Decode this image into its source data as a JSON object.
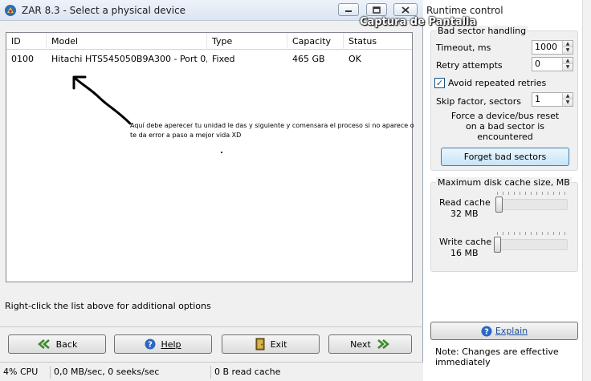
{
  "window": {
    "title": "ZAR 8.3 - Select a physical device",
    "watermark": "Captura de Pantalla"
  },
  "table": {
    "columns": [
      "ID",
      "Model",
      "Type",
      "Capacity",
      "Status"
    ],
    "rows": [
      {
        "id": "0100",
        "model": "Hitachi HTS545050B9A300 - Port 0, ...",
        "type": "Fixed",
        "capacity": "465 GB",
        "status": "OK"
      }
    ]
  },
  "annotation": {
    "text": "Aquí debe aperecer tu unidad le das y siguiente y comensara el proceso si no aparece o te da error a paso a mejor vida XD"
  },
  "hint": "Right-click the list above for additional options",
  "buttons": {
    "back": "Back",
    "help": "Help",
    "exit": "Exit",
    "next": "Next"
  },
  "status": {
    "cpu": "4% CPU",
    "io": "0,0 MB/sec, 0 seeks/sec",
    "cache": "0 B read cache"
  },
  "runtime": {
    "title": "Runtime control",
    "bad_sector_group": "Bad sector handling",
    "timeout_label": "Timeout, ms",
    "timeout_value": "1000",
    "retry_label": "Retry attempts",
    "retry_value": "0",
    "avoid_label": "Avoid repeated retries",
    "avoid_checked": true,
    "skip_label": "Skip factor, sectors",
    "skip_value": "1",
    "force_text_1": "Force a device/bus reset",
    "force_text_2": "on a bad sector is",
    "force_text_3": "encountered",
    "forget_button": "Forget bad sectors",
    "cache_group": "Maximum disk cache size, MB",
    "read_cache_label": "Read cache",
    "read_cache_value": "32 MB",
    "read_cache_level": 0.03,
    "write_cache_label": "Write cache",
    "write_cache_value": "16 MB",
    "write_cache_level": 0.0,
    "explain_button": "Explain",
    "note": "Note: Changes are effective immediately"
  },
  "colors": {
    "accent": "#3c7fb1",
    "link": "#1b4fa0",
    "check": "#1c5180"
  },
  "icons": {
    "app": "app-icon",
    "back": "double-arrow-left-icon",
    "help": "help-icon",
    "exit": "door-exit-icon",
    "next": "double-arrow-right-icon",
    "explain": "help-icon"
  }
}
